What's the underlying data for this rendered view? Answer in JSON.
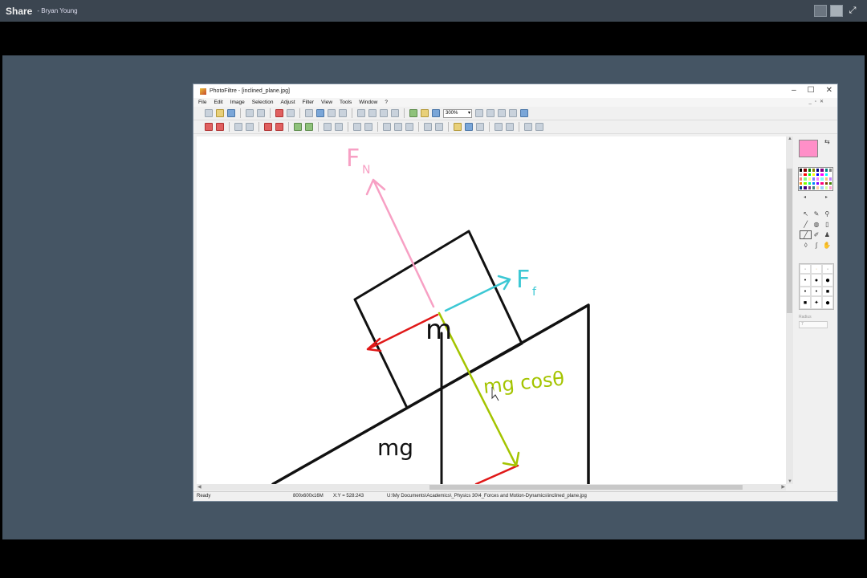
{
  "share_bar": {
    "title": "Share",
    "user": "- Bryan Young"
  },
  "window": {
    "title": "PhotoFiltre - [inclined_plane.jpg]",
    "menu": [
      "File",
      "Edit",
      "Image",
      "Selection",
      "Adjust",
      "Filter",
      "View",
      "Tools",
      "Window",
      "?"
    ],
    "zoom": "300%",
    "status": {
      "ready": "Ready",
      "image_info": "800x600x16M",
      "coords": "X:Y = 528:243",
      "path": "U:\\My Documents\\Academics\\_Physics 30\\4_Forces and Motion-Dynamics\\inclined_plane.jpg"
    },
    "palette": {
      "foreground": "#ff8fc8",
      "radius_label": "Radius",
      "radius_value": "7"
    }
  },
  "drawing": {
    "normal_force_label": "F",
    "normal_force_sub": "N",
    "friction_label": "F",
    "friction_sub": "f",
    "block_label": "m",
    "gravity_label": "mg",
    "component_label": "mg cosθ",
    "colors": {
      "normal": "#f7a0c4",
      "friction": "#3cc8d4",
      "parallel": "#e01818",
      "component": "#a4c400",
      "ink": "#111111"
    }
  }
}
